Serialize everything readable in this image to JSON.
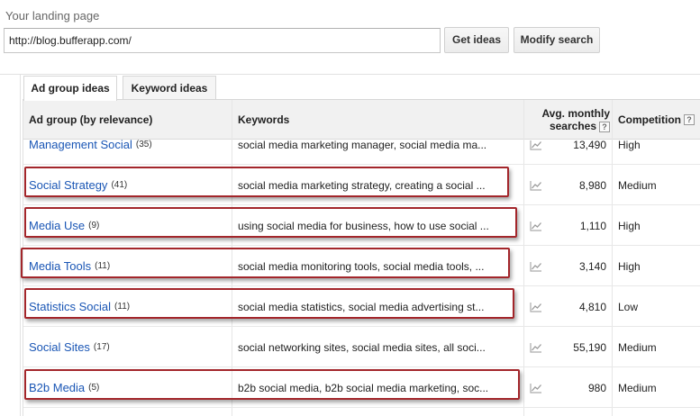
{
  "landing_page": {
    "label": "Your landing page",
    "url_value": "http://blog.bufferapp.com/"
  },
  "buttons": {
    "get_ideas": "Get ideas",
    "modify_search": "Modify search"
  },
  "tabs": [
    {
      "label": "Ad group ideas",
      "active": true
    },
    {
      "label": "Keyword ideas",
      "active": false
    }
  ],
  "table": {
    "headers": {
      "ad_group": "Ad group (by relevance)",
      "keywords": "Keywords",
      "avg_line1": "Avg. monthly",
      "avg_line2": "searches",
      "competition": "Competition",
      "help": "?"
    },
    "rows": [
      {
        "name": "Management Social",
        "count": "(35)",
        "keywords": "social media marketing manager, social media ma...",
        "avg": "13,490",
        "competition": "High",
        "highlighted": false
      },
      {
        "name": "Social Strategy",
        "count": "(41)",
        "keywords": "social media marketing strategy, creating a social ...",
        "avg": "8,980",
        "competition": "Medium",
        "highlighted": true
      },
      {
        "name": "Media Use",
        "count": "(9)",
        "keywords": "using social media for business, how to use social ...",
        "avg": "1,110",
        "competition": "High",
        "highlighted": true
      },
      {
        "name": "Media Tools",
        "count": "(11)",
        "keywords": "social media monitoring tools, social media tools, ...",
        "avg": "3,140",
        "competition": "High",
        "highlighted": true
      },
      {
        "name": "Statistics Social",
        "count": "(11)",
        "keywords": "social media statistics, social media advertising st...",
        "avg": "4,810",
        "competition": "Low",
        "highlighted": true
      },
      {
        "name": "Social Sites",
        "count": "(17)",
        "keywords": "social networking sites, social media sites, all soci...",
        "avg": "55,190",
        "competition": "Medium",
        "highlighted": false
      },
      {
        "name": "B2b Media",
        "count": "(5)",
        "keywords": "b2b social media, b2b social media marketing, soc...",
        "avg": "980",
        "competition": "Medium",
        "highlighted": true
      }
    ]
  },
  "icons": {
    "trend": "trend-chart-icon"
  },
  "colors": {
    "link": "#1a56b5",
    "highlight": "#a3262b"
  }
}
